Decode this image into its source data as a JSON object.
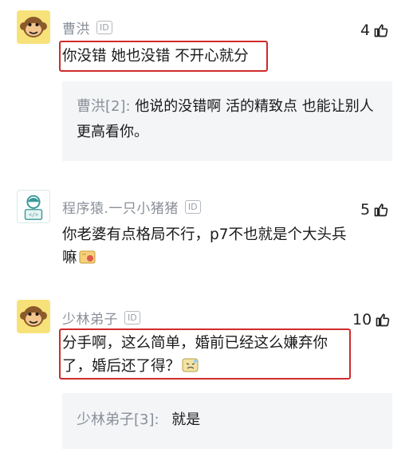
{
  "comments": [
    {
      "username": "曹洪",
      "badge": "ID",
      "likes": "4",
      "content": "你没错 她也没错 不开心就分",
      "reply": {
        "author": "曹洪[2]:",
        "text": "他说的没错啊  活的精致点 也能让别人更高看你。"
      }
    },
    {
      "username": "程序猿.一只小猪猪",
      "badge": "ID",
      "likes": "5",
      "content_line1": "你老婆有点格局不行，p7不也就是个大头兵",
      "content_line2": "嘛"
    },
    {
      "username": "少林弟子",
      "badge": "ID",
      "likes": "10",
      "content_line1": "分手啊，这么简单，婚前已经这么嫌弃你",
      "content_line2": "了，婚后还了得？",
      "reply": {
        "author": "少林弟子[3]:",
        "text": "就是"
      }
    }
  ],
  "colors": {
    "highlight": "#d12b2b",
    "reply_bg": "#f4f5f7",
    "name": "#8a8f99"
  }
}
